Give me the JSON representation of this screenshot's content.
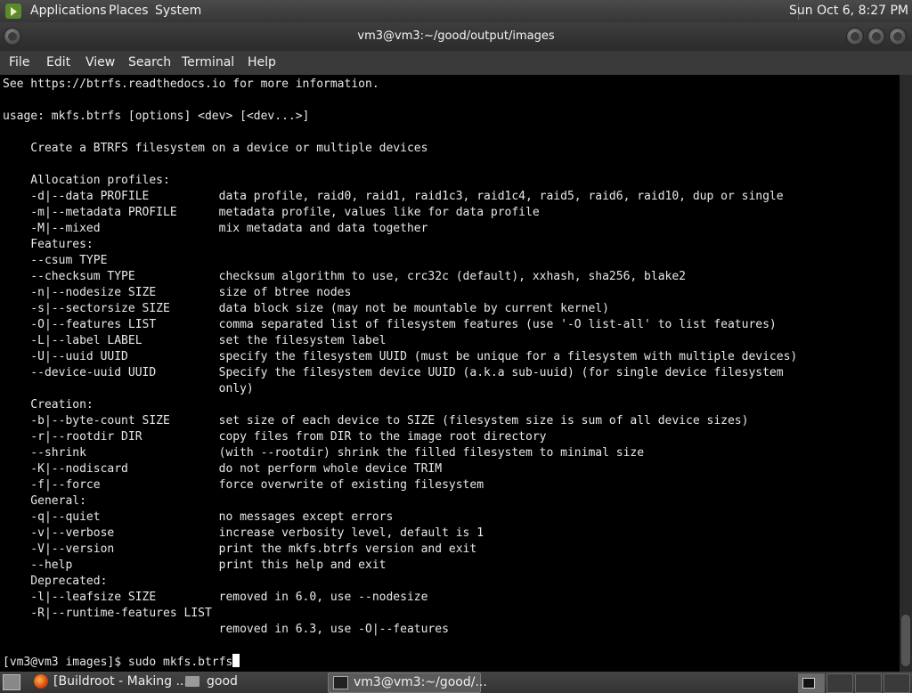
{
  "top_panel": {
    "menus": [
      "Applications",
      "Places",
      "System"
    ],
    "clock": "Sun Oct  6,  8:27 PM"
  },
  "window": {
    "title": "vm3@vm3:~/good/output/images"
  },
  "menubar": {
    "items": [
      "File",
      "Edit",
      "View",
      "Search",
      "Terminal",
      "Help"
    ]
  },
  "terminal": {
    "lines": [
      "See https://btrfs.readthedocs.io for more information.",
      "",
      "usage: mkfs.btrfs [options] <dev> [<dev...>]",
      "",
      "    Create a BTRFS filesystem on a device or multiple devices",
      "",
      "    Allocation profiles:",
      "    -d|--data PROFILE          data profile, raid0, raid1, raid1c3, raid1c4, raid5, raid6, raid10, dup or single",
      "    -m|--metadata PROFILE      metadata profile, values like for data profile",
      "    -M|--mixed                 mix metadata and data together",
      "    Features:",
      "    --csum TYPE",
      "    --checksum TYPE            checksum algorithm to use, crc32c (default), xxhash, sha256, blake2",
      "    -n|--nodesize SIZE         size of btree nodes",
      "    -s|--sectorsize SIZE       data block size (may not be mountable by current kernel)",
      "    -O|--features LIST         comma separated list of filesystem features (use '-O list-all' to list features)",
      "    -L|--label LABEL           set the filesystem label",
      "    -U|--uuid UUID             specify the filesystem UUID (must be unique for a filesystem with multiple devices)",
      "    --device-uuid UUID         Specify the filesystem device UUID (a.k.a sub-uuid) (for single device filesystem",
      "                               only)",
      "    Creation:",
      "    -b|--byte-count SIZE       set size of each device to SIZE (filesystem size is sum of all device sizes)",
      "    -r|--rootdir DIR           copy files from DIR to the image root directory",
      "    --shrink                   (with --rootdir) shrink the filled filesystem to minimal size",
      "    -K|--nodiscard             do not perform whole device TRIM",
      "    -f|--force                 force overwrite of existing filesystem",
      "    General:",
      "    -q|--quiet                 no messages except errors",
      "    -v|--verbose               increase verbosity level, default is 1",
      "    -V|--version               print the mkfs.btrfs version and exit",
      "    --help                     print this help and exit",
      "    Deprecated:",
      "    -l|--leafsize SIZE         removed in 6.0, use --nodesize",
      "    -R|--runtime-features LIST",
      "                               removed in 6.3, use -O|--features",
      ""
    ],
    "prompt": "[vm3@vm3 images]$ sudo mkfs.btrfs"
  },
  "taskbar": {
    "tasks": [
      "[Buildroot - Making ...",
      "good",
      "vm3@vm3:~/good/..."
    ]
  }
}
